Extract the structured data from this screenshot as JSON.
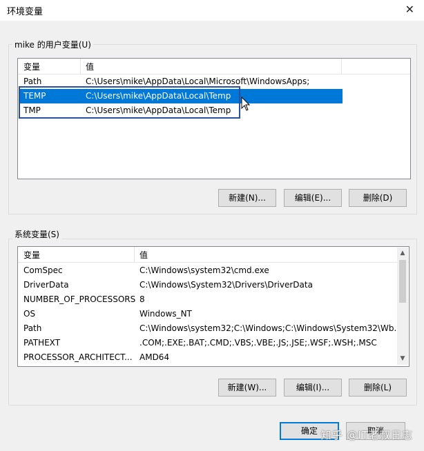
{
  "window": {
    "title": "环境变量",
    "close_glyph": "✕"
  },
  "user_vars": {
    "group_label": "mike 的用户变量(U)",
    "columns": [
      "变量",
      "值"
    ],
    "rows": [
      {
        "name": "Path",
        "value": "C:\\Users\\mike\\AppData\\Local\\Microsoft\\WindowsApps;"
      },
      {
        "name": "TEMP",
        "value": "C:\\Users\\mike\\AppData\\Local\\Temp",
        "selected": true
      },
      {
        "name": "TMP",
        "value": "C:\\Users\\mike\\AppData\\Local\\Temp"
      }
    ],
    "buttons": {
      "new": "新建(N)...",
      "edit": "编辑(E)...",
      "delete": "删除(D)"
    }
  },
  "system_vars": {
    "group_label": "系统变量(S)",
    "columns": [
      "变量",
      "值"
    ],
    "rows": [
      {
        "name": "ComSpec",
        "value": "C:\\Windows\\system32\\cmd.exe"
      },
      {
        "name": "DriverData",
        "value": "C:\\Windows\\System32\\Drivers\\DriverData"
      },
      {
        "name": "NUMBER_OF_PROCESSORS",
        "value": "8"
      },
      {
        "name": "OS",
        "value": "Windows_NT"
      },
      {
        "name": "Path",
        "value": "C:\\Windows\\system32;C:\\Windows;C:\\Windows\\System32\\Wb..."
      },
      {
        "name": "PATHEXT",
        "value": ".COM;.EXE;.BAT;.CMD;.VBS;.VBE;.JS;.JSE;.WSF;.WSH;.MSC"
      },
      {
        "name": "PROCESSOR_ARCHITECT...",
        "value": "AMD64"
      }
    ],
    "buttons": {
      "new": "新建(W)...",
      "edit": "编辑(I)...",
      "delete": "删除(L)"
    }
  },
  "footer": {
    "ok": "确定",
    "cancel": "取消"
  },
  "watermark": "知乎 @IT老叔日志",
  "colors": {
    "selection": "#0078d7",
    "highlight_box": "#2b4ea0"
  }
}
